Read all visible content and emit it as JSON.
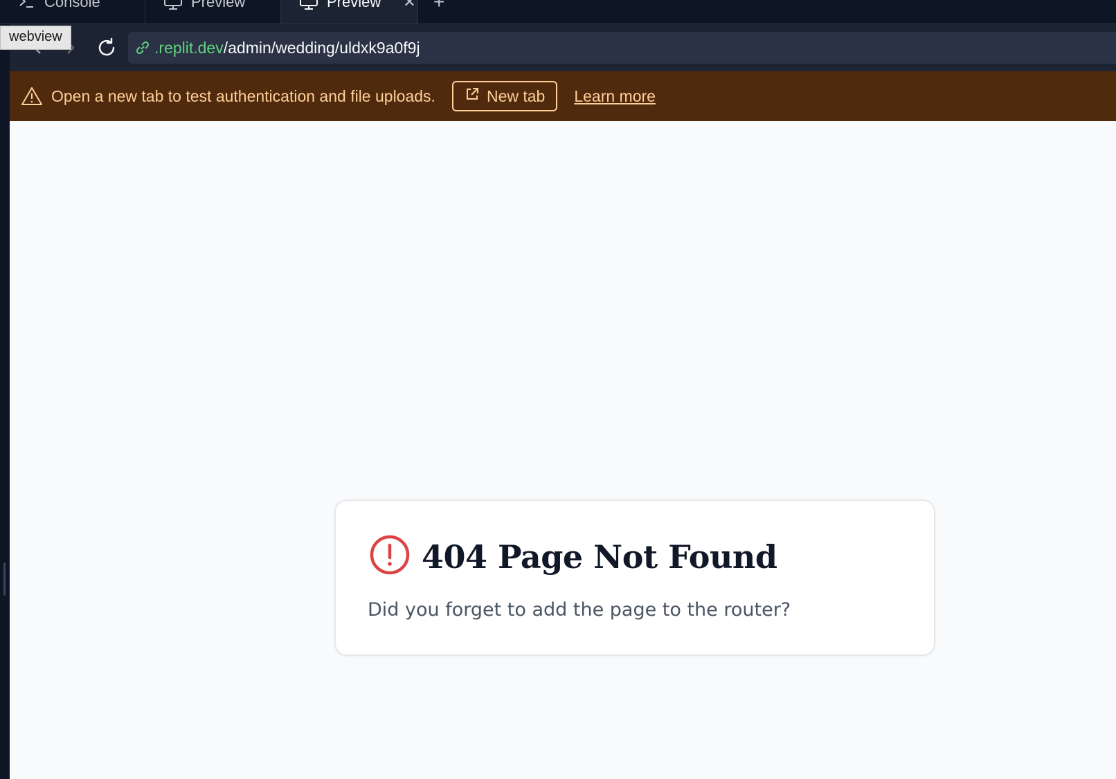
{
  "tabs": [
    {
      "label": "Console",
      "icon": "terminal-icon",
      "active": false
    },
    {
      "label": "Preview",
      "icon": "monitor-icon",
      "active": false
    },
    {
      "label": "Preview",
      "icon": "monitor-icon",
      "active": true
    }
  ],
  "tooltip": "webview",
  "url": {
    "host": ".replit.dev",
    "path": "/admin/wedding/uldxk9a0f9j"
  },
  "banner": {
    "message": "Open a new tab to test authentication and file uploads.",
    "button_label": "New tab",
    "link_label": "Learn more"
  },
  "page": {
    "title": "404 Page Not Found",
    "message": "Did you forget to add the page to the router?"
  },
  "colors": {
    "banner_bg": "#4f2a0d",
    "banner_text": "#ffcf99",
    "url_host": "#5ed27e",
    "error_icon": "#dc4444"
  }
}
